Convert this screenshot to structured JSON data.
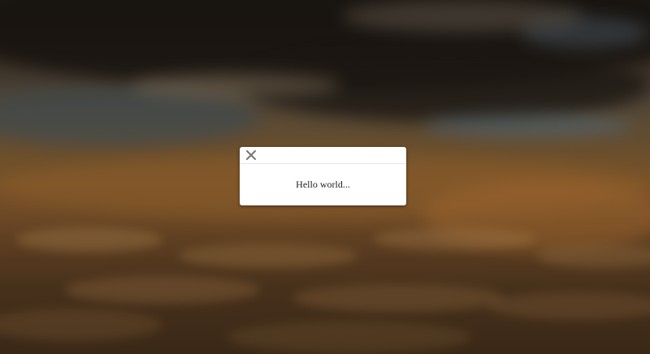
{
  "modal": {
    "message": "Hello world..."
  },
  "icons": {
    "close": "close-icon"
  },
  "colors": {
    "modal_background": "#ffffff",
    "close_icon": "#777777",
    "text": "#222222"
  }
}
